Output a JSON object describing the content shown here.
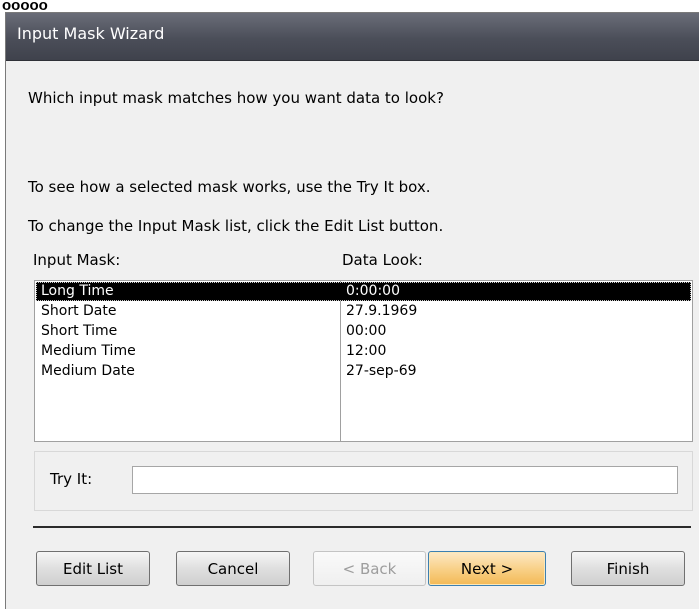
{
  "window": {
    "title": "Input Mask Wizard"
  },
  "prompt": "Which input mask matches how you want data to look?",
  "instructions": [
    "To see how a selected mask works, use the Try It box.",
    "To change the Input Mask list, click the Edit List button."
  ],
  "list": {
    "headers": {
      "mask": "Input Mask:",
      "look": "Data Look:"
    },
    "rows": [
      {
        "mask": "Long Time",
        "look": "0:00:00",
        "selected": true
      },
      {
        "mask": "Short Date",
        "look": "27.9.1969"
      },
      {
        "mask": "Short Time",
        "look": "00:00"
      },
      {
        "mask": "Medium Time",
        "look": "12:00"
      },
      {
        "mask": "Medium Date",
        "look": "27-sep-69"
      }
    ]
  },
  "tryit": {
    "label": "Try It:",
    "value": ""
  },
  "buttons": {
    "edit_list": "Edit List",
    "cancel": "Cancel",
    "back": "< Back",
    "next": "Next >",
    "finish": "Finish"
  }
}
